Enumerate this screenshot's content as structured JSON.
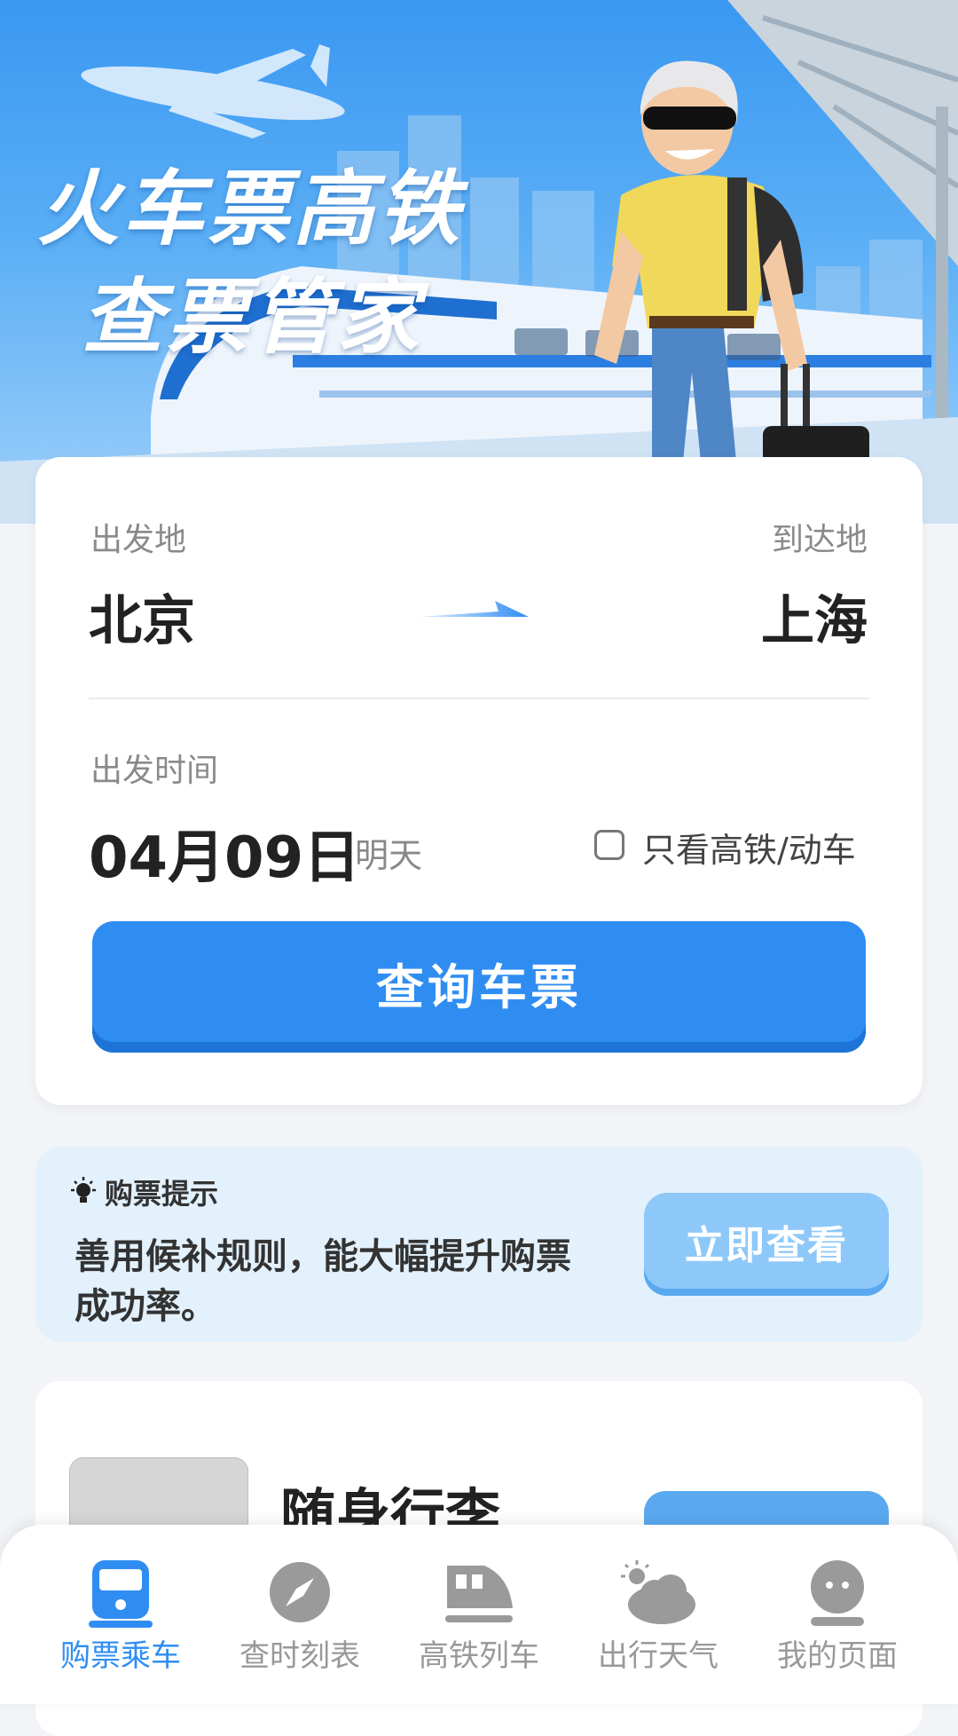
{
  "hero": {
    "title_line1": "火车票高铁",
    "title_line2": "查票管家"
  },
  "search": {
    "from_label": "出发地",
    "from_city": "北京",
    "to_label": "到达地",
    "to_city": "上海",
    "date_label": "出发时间",
    "date_value": "04月09日",
    "date_relative": "明天",
    "filter_label": "只看高铁/动车",
    "filter_checked": false,
    "search_button": "查询车票"
  },
  "tip": {
    "title": "购票提示",
    "text": "善用候补规则，能大幅提升购票成功率。",
    "button": "立即查看"
  },
  "luggage": {
    "title": "随身行李"
  },
  "nav": {
    "items": [
      {
        "label": "购票乘车",
        "icon": "train-front-icon",
        "active": true
      },
      {
        "label": "查时刻表",
        "icon": "compass-icon",
        "active": false
      },
      {
        "label": "高铁列车",
        "icon": "bullet-train-icon",
        "active": false
      },
      {
        "label": "出行天气",
        "icon": "weather-cloud-icon",
        "active": false
      },
      {
        "label": "我的页面",
        "icon": "profile-icon",
        "active": false
      }
    ]
  },
  "colors": {
    "accent": "#2f8df2",
    "hero_blue": "#3a98f2",
    "tip_bg": "#e3f1fd",
    "nav_inactive": "#999999"
  }
}
